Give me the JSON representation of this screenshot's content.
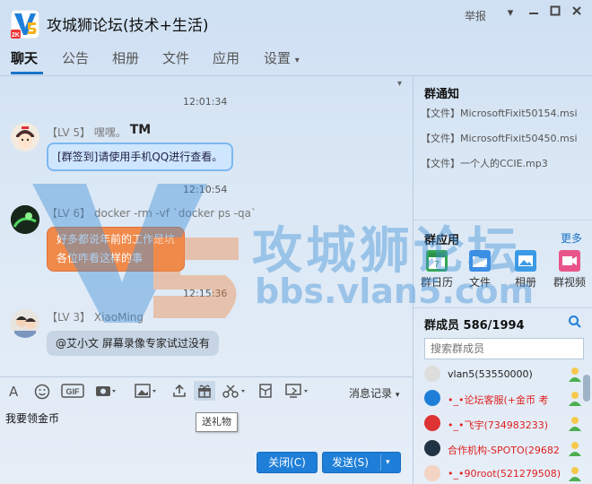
{
  "window": {
    "title": "攻城狮论坛(技术+生活)",
    "report_label": "举报",
    "logo_badge": "2K"
  },
  "tabs": [
    "聊天",
    "公告",
    "相册",
    "文件",
    "应用",
    "设置"
  ],
  "messages": [
    {
      "time": "12:01:34",
      "level": "【LV 5】",
      "name": "嘿嘿。",
      "name_suffix": "TM",
      "text": "[群签到]请使用手机QQ进行查看。"
    },
    {
      "time": "12:10:54",
      "level": "【LV 6】",
      "name": "docker -rm -vf `docker  ps -qa`",
      "lines": [
        "好多都说年前的工作是坑",
        "各位咋看这样的事"
      ]
    },
    {
      "time": "12:15:36",
      "level": "【LV 3】",
      "name": "XiaoMing",
      "text": "@艾小文 屏幕录像专家试过没有"
    }
  ],
  "toolbar": {
    "history_label": "消息记录",
    "gif_label": "GIF",
    "tooltip": "送礼物"
  },
  "input": {
    "value": "我要领金币"
  },
  "buttons": {
    "close": "关闭(C)",
    "send": "发送(S)"
  },
  "right": {
    "notice_title": "群通知",
    "notices": [
      "【文件】MicrosoftFixit50154.msi",
      "【文件】MicrosoftFixit50450.msi",
      "【文件】一个人的CCIE.mp3"
    ],
    "apps_title": "群应用",
    "apps_more": "更多",
    "apps": [
      "群日历",
      "文件",
      "相册",
      "群视频"
    ],
    "calendar_day": "7",
    "members_title": "群成员 586/1994",
    "search_placeholder": "搜索群成员",
    "members": [
      {
        "name": "vlan5(53550000)",
        "color": "#222222"
      },
      {
        "name": "•_•论坛客服(+金币 考",
        "color": "#e02020"
      },
      {
        "name": "•_•飞宇(734983233)",
        "color": "#e02020"
      },
      {
        "name": "合作机构-SPOTO(29682",
        "color": "#e02020"
      },
      {
        "name": "•_•90root(521279508)",
        "color": "#e02020"
      }
    ]
  },
  "watermark": {
    "title": "攻城狮论坛",
    "url": "bbs.vlan5.com"
  },
  "colors": {
    "accent": "#1f7fd8",
    "orange": "#f08a4a",
    "member_red": "#e02020"
  }
}
